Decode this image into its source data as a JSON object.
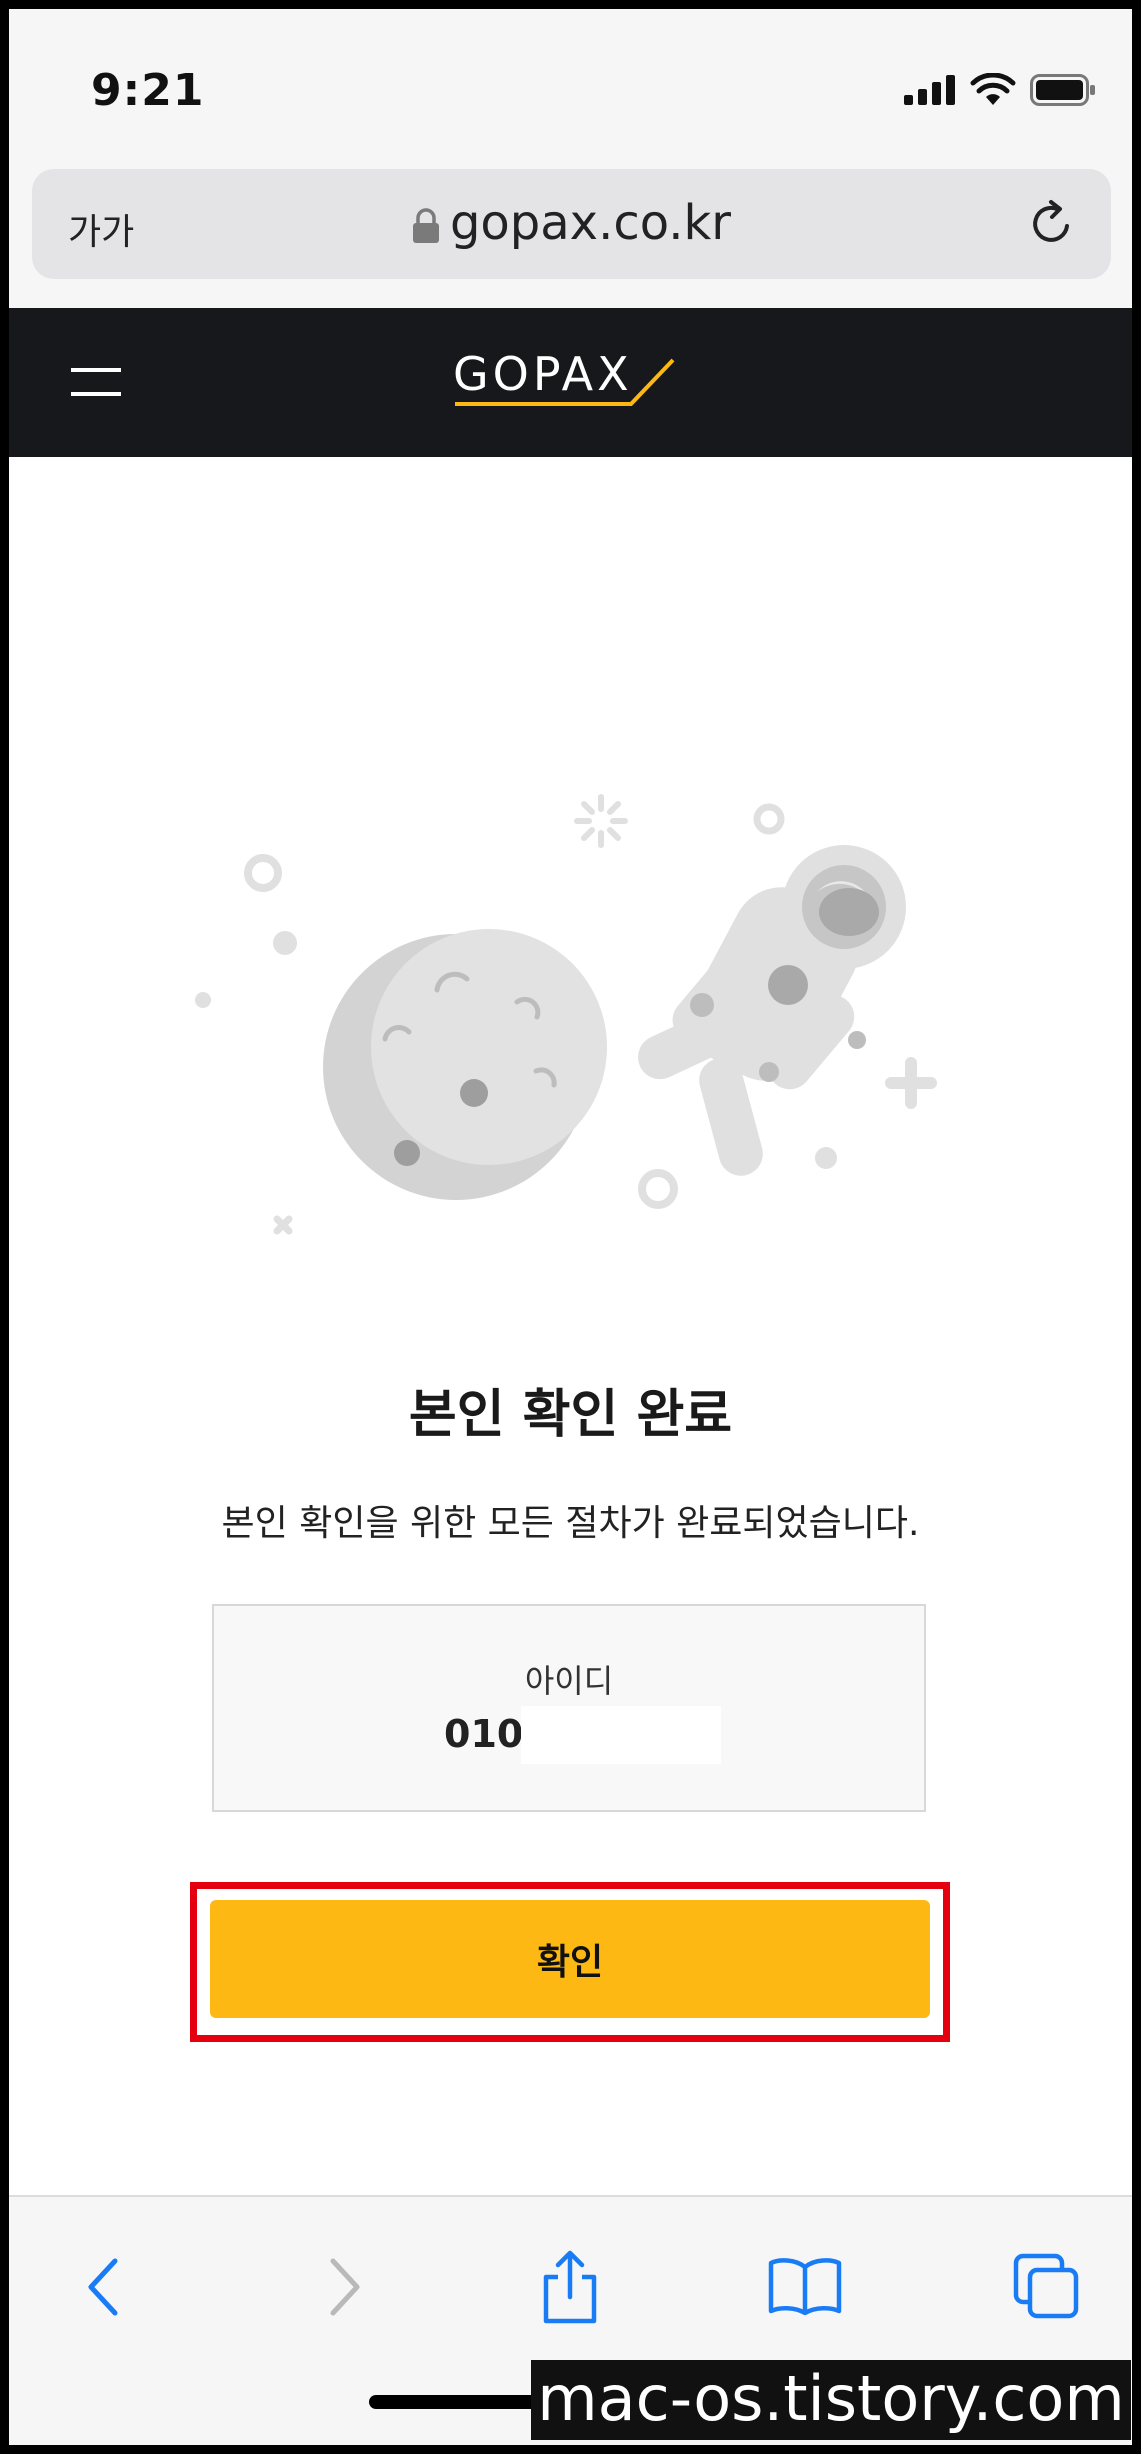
{
  "status_bar": {
    "time": "9:21"
  },
  "browser": {
    "text_size_label": "가가",
    "url": "gopax.co.kr"
  },
  "site": {
    "logo_text": "GOPAX"
  },
  "main": {
    "title": "본인 확인 완료",
    "description": "본인 확인을 위한 모든 절차가 완료되었습니다.",
    "id_label": "아이디",
    "id_value": "010",
    "confirm_label": "확인"
  },
  "colors": {
    "accent": "#fdb814",
    "header_bg": "#17181c",
    "highlight": "#e5000f",
    "ios_blue": "#1a7cf5"
  },
  "watermark": "mac-os.tistory.com"
}
